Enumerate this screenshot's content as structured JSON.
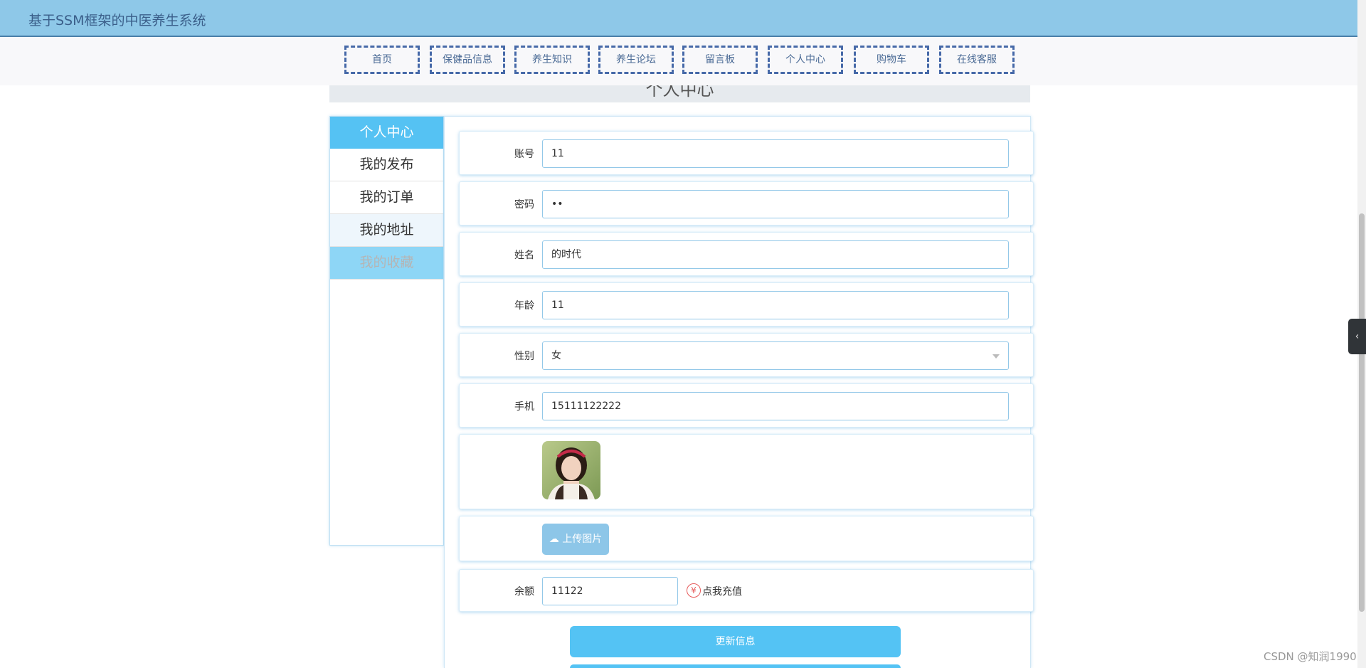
{
  "header": {
    "title": "基于SSM框架的中医养生系统"
  },
  "nav": [
    "首页",
    "保健品信息",
    "养生知识",
    "养生论坛",
    "留言板",
    "个人中心",
    "购物车",
    "在线客服"
  ],
  "page_title": "个人中心",
  "sidebar": {
    "heading": "个人中心",
    "items": [
      "我的发布",
      "我的订单",
      "我的地址",
      "我的收藏"
    ]
  },
  "form": {
    "account": {
      "label": "账号",
      "value": "11"
    },
    "password": {
      "label": "密码",
      "value": "••"
    },
    "name": {
      "label": "姓名",
      "value": "的时代"
    },
    "age": {
      "label": "年龄",
      "value": "11"
    },
    "gender": {
      "label": "性别",
      "value": "女"
    },
    "phone": {
      "label": "手机",
      "value": "15111122222"
    },
    "upload_label": "上传图片",
    "balance": {
      "label": "余额",
      "value": "11122",
      "recharge": "点我充值",
      "yen_icon": "¥"
    }
  },
  "buttons": {
    "update": "更新信息"
  },
  "watermark": "CSDN @知润1990",
  "colors": {
    "topbar": "#8ec8e8",
    "accent": "#54c3f4",
    "nav_border": "#4669a8"
  }
}
